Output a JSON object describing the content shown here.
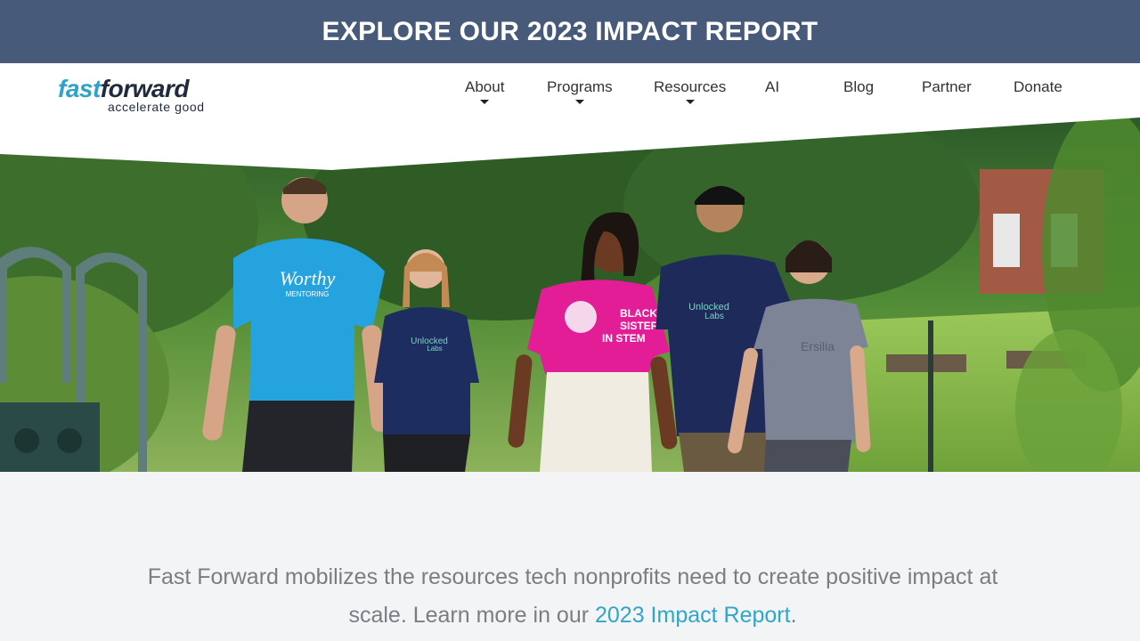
{
  "banner": {
    "text": "EXPLORE OUR 2023 IMPACT REPORT"
  },
  "logo": {
    "word1": "fast",
    "word2": "forward",
    "tagline": "accelerate good"
  },
  "nav": {
    "items": [
      {
        "label": "About",
        "dropdown": true
      },
      {
        "label": "Programs",
        "dropdown": true
      },
      {
        "label": "Resources",
        "dropdown": true
      },
      {
        "label": "AI",
        "dropdown": false
      },
      {
        "label": "Blog",
        "dropdown": false
      },
      {
        "label": "Partner",
        "dropdown": false
      },
      {
        "label": "Donate",
        "dropdown": false
      }
    ]
  },
  "hero": {
    "shirts": {
      "worthy": "Worthy",
      "worthy_sub": "MENTORING",
      "unlocked": "Unlocked",
      "labs": "Labs",
      "black": "BLACK",
      "sisters": "SISTERS",
      "stem": "IN STEM",
      "brand": "Ersilia"
    }
  },
  "intro": {
    "text_before": "Fast Forward mobilizes the resources tech nonprofits need to create positive impact at scale. Learn more in our ",
    "link_text": "2023 Impact Report",
    "text_after": "."
  },
  "colors": {
    "banner_bg": "#475a7a",
    "link": "#30a6c9",
    "logo_fast": "#2ea3c9",
    "logo_forward": "#1f2a3c"
  }
}
